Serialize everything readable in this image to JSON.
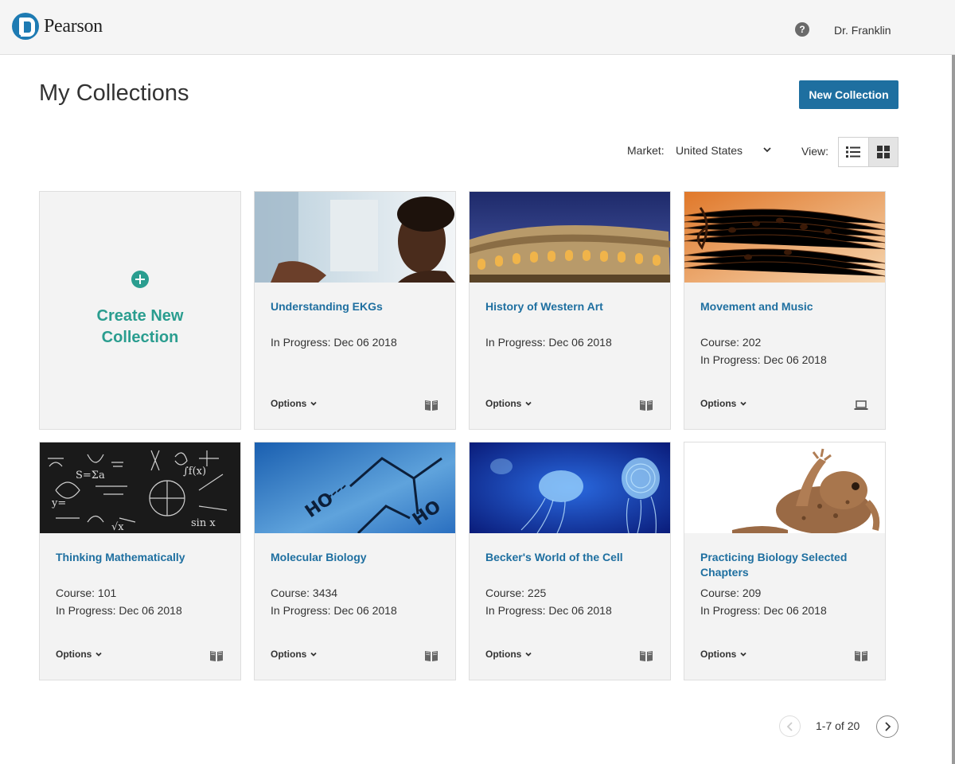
{
  "header": {
    "brand": "Pearson",
    "help_glyph": "?",
    "user_name": "Dr. Franklin"
  },
  "page": {
    "title": "My Collections",
    "new_collection_label": "New Collection"
  },
  "filters": {
    "market_label": "Market:",
    "market_value": "United States",
    "view_label": "View:",
    "view_mode": "grid"
  },
  "create_card": {
    "line1": "Create New",
    "line2": "Collection"
  },
  "cards": [
    {
      "title": "Understanding EKGs",
      "course": "",
      "progress": "In Progress: Dec 06 2018",
      "options": "Options",
      "type_icon": "book-icon",
      "image": "doctor-xray"
    },
    {
      "title": "History of Western Art",
      "course": "",
      "progress": "In Progress: Dec 06 2018",
      "options": "Options",
      "type_icon": "book-icon",
      "image": "colosseum"
    },
    {
      "title": "Movement and Music",
      "course": "Course: 202",
      "progress": "In Progress: Dec 06 2018",
      "options": "Options",
      "type_icon": "laptop-icon",
      "image": "sheet-music"
    },
    {
      "title": "Thinking Mathematically",
      "course": "Course: 101",
      "progress": "In Progress: Dec 06 2018",
      "options": "Options",
      "type_icon": "book-icon",
      "image": "chalkboard-math"
    },
    {
      "title": "Molecular Biology",
      "course": "Course: 3434",
      "progress": "In Progress: Dec 06 2018",
      "options": "Options",
      "type_icon": "book-icon",
      "image": "molecule"
    },
    {
      "title": "Becker's World of the Cell",
      "course": "Course: 225",
      "progress": "In Progress: Dec 06 2018",
      "options": "Options",
      "type_icon": "book-icon",
      "image": "jellyfish"
    },
    {
      "title": "Practicing Biology Selected Chapters",
      "course": "Course: 209",
      "progress": "In Progress: Dec 06 2018",
      "options": "Options",
      "type_icon": "book-icon",
      "image": "frog"
    }
  ],
  "pagination": {
    "text": "1-7 of 20"
  },
  "colors": {
    "brand_blue": "#1e6fa0",
    "create_teal": "#2a9d8f",
    "card_bg": "#f3f3f3"
  }
}
